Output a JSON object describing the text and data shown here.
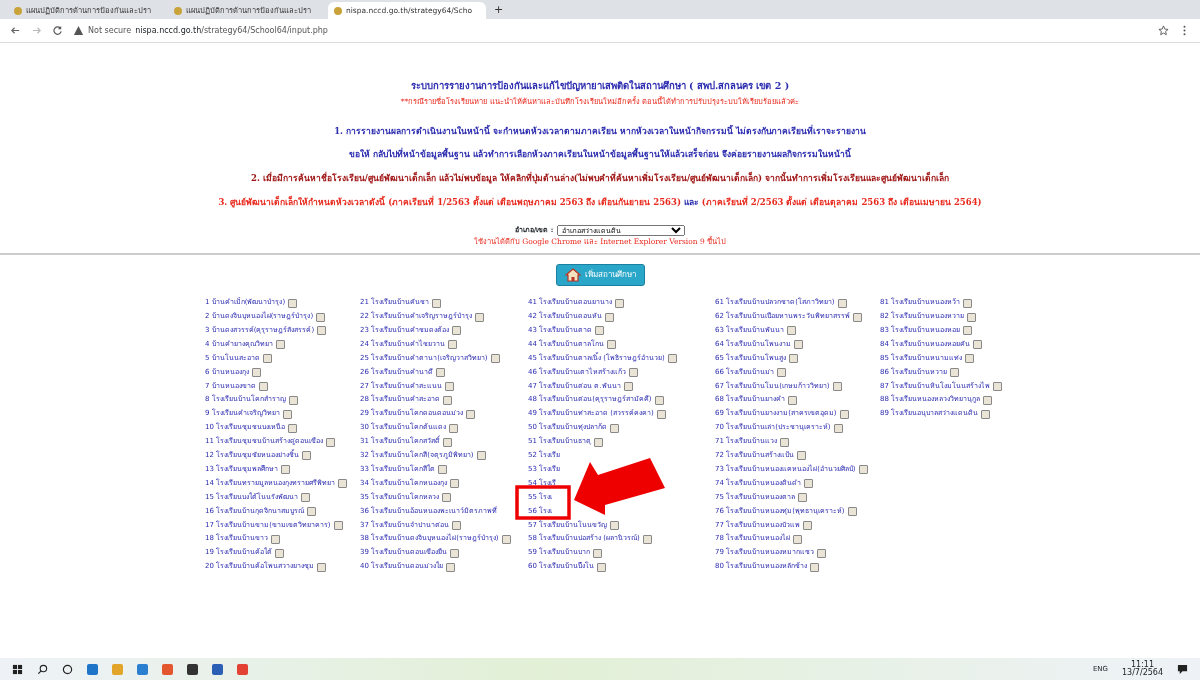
{
  "browser": {
    "tabs": [
      {
        "title": "แผนปฏิบัติการด้านการป้องกันและปรา",
        "selected": false
      },
      {
        "title": "แผนปฏิบัติการด้านการป้องกันและปรา",
        "selected": false
      },
      {
        "title": "nispa.nccd.go.th/strategy64/Scho",
        "selected": true
      }
    ],
    "new_tab": "+",
    "security": "Not secure",
    "url_host": "nispa.nccd.go.th",
    "url_path": "/strategy64/School64/input.php"
  },
  "header": {
    "title": "ระบบการรายงานการป้องกันและแก้ไขปัญหายาเสพติดในสถานศึกษา ( สพป.สกลนคร เขต 2 )",
    "note": "**กรณีรายชื่อโรงเรียนหาย แนะนำให้ค้นหาและบันทึกโรงเรียนใหม่อีกครั้ง ตอนนี้ได้ทำการปรับปรุงระบบให้เรียบร้อยแล้วค่ะ",
    "lines": [
      {
        "parts": [
          {
            "text": "1. การรายงานผลการดำเนินงานในหน้านี้ จะกำหนดห้วงเวลาตามภาคเรียน หากห้วงเวลาในหน้ากิจกรรมนี้ ไม่ตรงกับภาคเรียนที่เราจะรายงาน",
            "color": "#2b2bb0"
          }
        ]
      },
      {
        "parts": [
          {
            "text": "ขอให้ กลับไปที่หน้าข้อมูลพื้นฐาน แล้วทำการเลือกห้วงภาคเรียนในหน้าข้อมูลพื้นฐานให้แล้วเสร็จก่อน จึงค่อยรายงานผลกิจกรรมในหน้านี้",
            "color": "#2b2bb0"
          }
        ]
      },
      {
        "parts": [
          {
            "text": "2. เมื่อมีการค้นหาชื่อโรงเรียน/ศูนย์พัฒนาเด็กเล็ก แล้วไม่พบข้อมูล ให้คลิกที่ปุ่มด้านล่าง(ไม่พบคำที่ค้นหาเพิ่มโรงเรียน/ศูนย์พัฒนาเด็กเล็ก) จากนั้นทำการเพิ่มโรงเรียนและศูนย์พัฒนาเด็กเล็ก",
            "color": "#a01515"
          }
        ]
      },
      {
        "parts": [
          {
            "text": "3. ศูนย์พัฒนาเด็กเล็กให้กำหนดห้วงเวลาดังนี้ (ภาคเรียนที่ 1/2563 ตั้งแต่ เดือนพฤษภาคม 2563 ถึง เดือนกันยายน 2563)",
            "color": "#e8291c"
          },
          {
            "text": "และ",
            "color": "#2b2bb0"
          },
          {
            "text": "(ภาคเรียนที่ 2/2563 ตั้งแต่ เดือนตุลาคม 2563 ถึง เดือนเมษายน 2564)",
            "color": "#e8291c"
          }
        ]
      }
    ]
  },
  "district": {
    "label": "อำเภอ/เขต :",
    "value": "อำเภอสว่างแดนดิน"
  },
  "browser_note": "ใช้งานได้ดีกับ Google Chrome และ Internet Explorer Version 9 ขึ้นไป",
  "add_button": "เพิ่มสถานศึกษา",
  "columns": [
    [
      {
        "text": "1 บ้านคำเม็ก(พัฒนาบำรุง)",
        "icon": true
      },
      {
        "text": "2 บ้านดงจินบุหนองไผ่(ราษฎร์บำรุง)",
        "icon": true
      },
      {
        "text": "3 บ้านดงสวรรค์(คุรุราษฎร์สังสรรค์)",
        "icon": true
      },
      {
        "text": "4 บ้านคำยางคุณวิทยา",
        "icon": true
      },
      {
        "text": "5 บ้านโนนสะอาด",
        "icon": true
      },
      {
        "text": "6 บ้านหนองกุง",
        "icon": true
      },
      {
        "text": "7 บ้านหนองขาด",
        "icon": true
      },
      {
        "text": "8 โรงเรียนบ้านโคกสำราญ",
        "icon": true
      },
      {
        "text": "9 โรงเรียนคำเจริญวิทยา",
        "icon": true
      },
      {
        "text": "10 โรงเรียนชุมชนบงเหนือ",
        "icon": true
      },
      {
        "text": "11 โรงเรียนชุมชนบ้านสร้างดู่ดอนเขือง",
        "icon": true
      },
      {
        "text": "12 โรงเรียนชุมชัยหนองย่างชิ้น",
        "icon": true
      },
      {
        "text": "13 โรงเรียนชุมพลศึกษา",
        "icon": true
      },
      {
        "text": "14 โรงเรียนทรายมูลหนองกุงทรายศรีพิทยา",
        "icon": true
      },
      {
        "text": "15 โรงเรียนบงใต้โนนรังพัฒนา",
        "icon": true
      },
      {
        "text": "16 โรงเรียนบ้านกุดจิกนาสมบูรณ์",
        "icon": true
      },
      {
        "text": "17 โรงเรียนบ้านขาม(ขามเขตวิทยาคาร)",
        "icon": true
      },
      {
        "text": "18 โรงเรียนบ้านขาว",
        "icon": true
      },
      {
        "text": "19 โรงเรียนบ้านค้อใต้",
        "icon": true
      },
      {
        "text": "20 โรงเรียนบ้านค้อโพนสวางยางชุม",
        "icon": true
      }
    ],
    [
      {
        "text": "21 โรงเรียนบ้านคันชา",
        "icon": true
      },
      {
        "text": "22 โรงเรียนบ้านคำเจริญราษฎร์บำรุง",
        "icon": true
      },
      {
        "text": "23 โรงเรียนบ้านคำชมดงต้อง",
        "icon": true
      },
      {
        "text": "24 โรงเรียนบ้านคำไชยวาน",
        "icon": true
      },
      {
        "text": "25 โรงเรียนบ้านคำตานา(เจริญวาสวิทยา)",
        "icon": true
      },
      {
        "text": "26 โรงเรียนบ้านคำนาดี",
        "icon": true
      },
      {
        "text": "27 โรงเรียนบ้านคำสะแนน",
        "icon": true
      },
      {
        "text": "28 โรงเรียนบ้านคำสะอาด",
        "icon": true
      },
      {
        "text": "29 โรงเรียนบ้านโคกดอนดอนม่วง",
        "icon": true
      },
      {
        "text": "30 โรงเรียนบ้านโคกต้นแดง",
        "icon": true
      },
      {
        "text": "31 โรงเรียนบ้านโคกสวัสดิ์",
        "icon": true
      },
      {
        "text": "32 โรงเรียนบ้านโคกสี(จตุรภูมิพิทยา)",
        "icon": true
      },
      {
        "text": "33 โรงเรียนบ้านโคกสีใต",
        "icon": true
      },
      {
        "text": "34 โรงเรียนบ้านโคกหนองกุง",
        "icon": true
      },
      {
        "text": "35 โรงเรียนบ้านโคกหลวง",
        "icon": true
      },
      {
        "text": "36 โรงเรียนบ้านอ้อนหนองพะเนาว์มิตรภาพที่",
        "icon": false
      },
      {
        "text": "37 โรงเรียนบ้านจำปานาต่อน",
        "icon": true
      },
      {
        "text": "38 โรงเรียนบ้านดงจินบุหนองไผ่(ราษฎร์บำรุง)",
        "icon": true
      },
      {
        "text": "39 โรงเรียนบ้านดอนเขืองยืน",
        "icon": true
      },
      {
        "text": "40 โรงเรียนบ้านดอนม่วงใย",
        "icon": true
      }
    ],
    [
      {
        "text": "41 โรงเรียนบ้านดอนยานาง",
        "icon": true
      },
      {
        "text": "42 โรงเรียนบ้านดอนหัน",
        "icon": true
      },
      {
        "text": "43 โรงเรียนบ้านตาด",
        "icon": true
      },
      {
        "text": "44 โรงเรียนบ้านตาลโกน",
        "icon": true
      },
      {
        "text": "45 โรงเรียนบ้านตาลเนิ้ง (โพธิราษฎร์อำนวย)",
        "icon": true
      },
      {
        "text": "46 โรงเรียนบ้านเตาไหสร้างแก้ว",
        "icon": true
      },
      {
        "text": "47 โรงเรียนบ้านต่อน ต.พันนา",
        "icon": true
      },
      {
        "text": "48 โรงเรียนบ้านต่อน(คุรุราษฎร์สามัคคี)",
        "icon": true
      },
      {
        "text": "49 โรงเรียนบ้านท่าสะอาด (สวรรค์คงคา)",
        "icon": true
      },
      {
        "text": "50 โรงเรียนบ้านทุ่งปลาก้ด",
        "icon": true
      },
      {
        "text": "51 โรงเรียนบ้านธาตุ",
        "icon": true
      },
      {
        "text": "52 โรงเรีย",
        "icon": false
      },
      {
        "text": "53 โรงเรีย",
        "icon": false
      },
      {
        "text": "54 โรงเรี",
        "icon": false
      },
      {
        "text": "55 โรงเ",
        "icon": false
      },
      {
        "text": "56 โรงเ",
        "icon": false
      },
      {
        "text": "57 โรงเรียนบ้านโนนขวัญ",
        "icon": true
      },
      {
        "text": "58 โรงเรียนบ้านบ่อสร้าง (ผลานิวรณ์)",
        "icon": true
      },
      {
        "text": "59 โรงเรียนบ้านบาก",
        "icon": true
      },
      {
        "text": "60 โรงเรียนบ้านบึงโน",
        "icon": true
      }
    ],
    [
      {
        "text": "61 โรงเรียนบ้านปลวกชาด(โสภาวิทยา)",
        "icon": true
      },
      {
        "text": "62 โรงเรียนบ้านเปือยหานพระวันพิทยาสรรพ์",
        "icon": true
      },
      {
        "text": "63 โรงเรียนบ้านพันนา",
        "icon": true
      },
      {
        "text": "64 โรงเรียนบ้านโพนงาม",
        "icon": true
      },
      {
        "text": "65 โรงเรียนบ้านโพนสูง",
        "icon": true
      },
      {
        "text": "66 โรงเรียนบ้านม่า",
        "icon": true
      },
      {
        "text": "67 โรงเรียนบ้านโมน(เกษมก้าววิทยา)",
        "icon": true
      },
      {
        "text": "68 โรงเรียนบ้านยางคำ",
        "icon": true
      },
      {
        "text": "69 โรงเรียนบ้านยางงาม(สาครเขตอุดม)",
        "icon": true
      },
      {
        "text": "70 โรงเรียนบ้านเล่า(ประชานุเคราะห์)",
        "icon": true
      },
      {
        "text": "71 โรงเรียนบ้านแวง",
        "icon": true
      },
      {
        "text": "72 โรงเรียนบ้านสร้างแป้น",
        "icon": true
      },
      {
        "text": "73 โรงเรียนบ้านหนองแคหนองไผ่(อำนวยศิลป์)",
        "icon": true
      },
      {
        "text": "74 โรงเรียนบ้านหนองดินดำ",
        "icon": true
      },
      {
        "text": "75 โรงเรียนบ้านหนองตาล",
        "icon": true
      },
      {
        "text": "76 โรงเรียนบ้านหนองทุ่ม(พุทธานุเคราะห์)",
        "icon": true
      },
      {
        "text": "77 โรงเรียนบ้านหนองบัวแพ",
        "icon": true
      },
      {
        "text": "78 โรงเรียนบ้านหนองไผ่",
        "icon": true
      },
      {
        "text": "79 โรงเรียนบ้านหนองหมากแซว",
        "icon": true
      },
      {
        "text": "80 โรงเรียนบ้านหนองหลักช้าง",
        "icon": true
      }
    ],
    [
      {
        "text": "81 โรงเรียนบ้านหนองหว้า",
        "icon": true
      },
      {
        "text": "82 โรงเรียนบ้านหนองหวาย",
        "icon": true
      },
      {
        "text": "83 โรงเรียนบ้านหนองหอย",
        "icon": true
      },
      {
        "text": "84 โรงเรียนบ้านหนองหอยคัน",
        "icon": true
      },
      {
        "text": "85 โรงเรียนบ้านหนามแท่ง",
        "icon": true
      },
      {
        "text": "86 โรงเรียนบ้านหวาย",
        "icon": true
      },
      {
        "text": "87 โรงเรียนบ้านหินโงมโนนสร้างไพ",
        "icon": true
      },
      {
        "text": "88 โรงเรียนหนองหลวงวิทยานุกูล",
        "icon": true
      },
      {
        "text": "89 โรงเรียนอนุบาลสว่างแดนดิน",
        "icon": true
      }
    ]
  ],
  "taskbar": {
    "language": "ENG",
    "time": "11:11",
    "date": "13/7/2564"
  }
}
